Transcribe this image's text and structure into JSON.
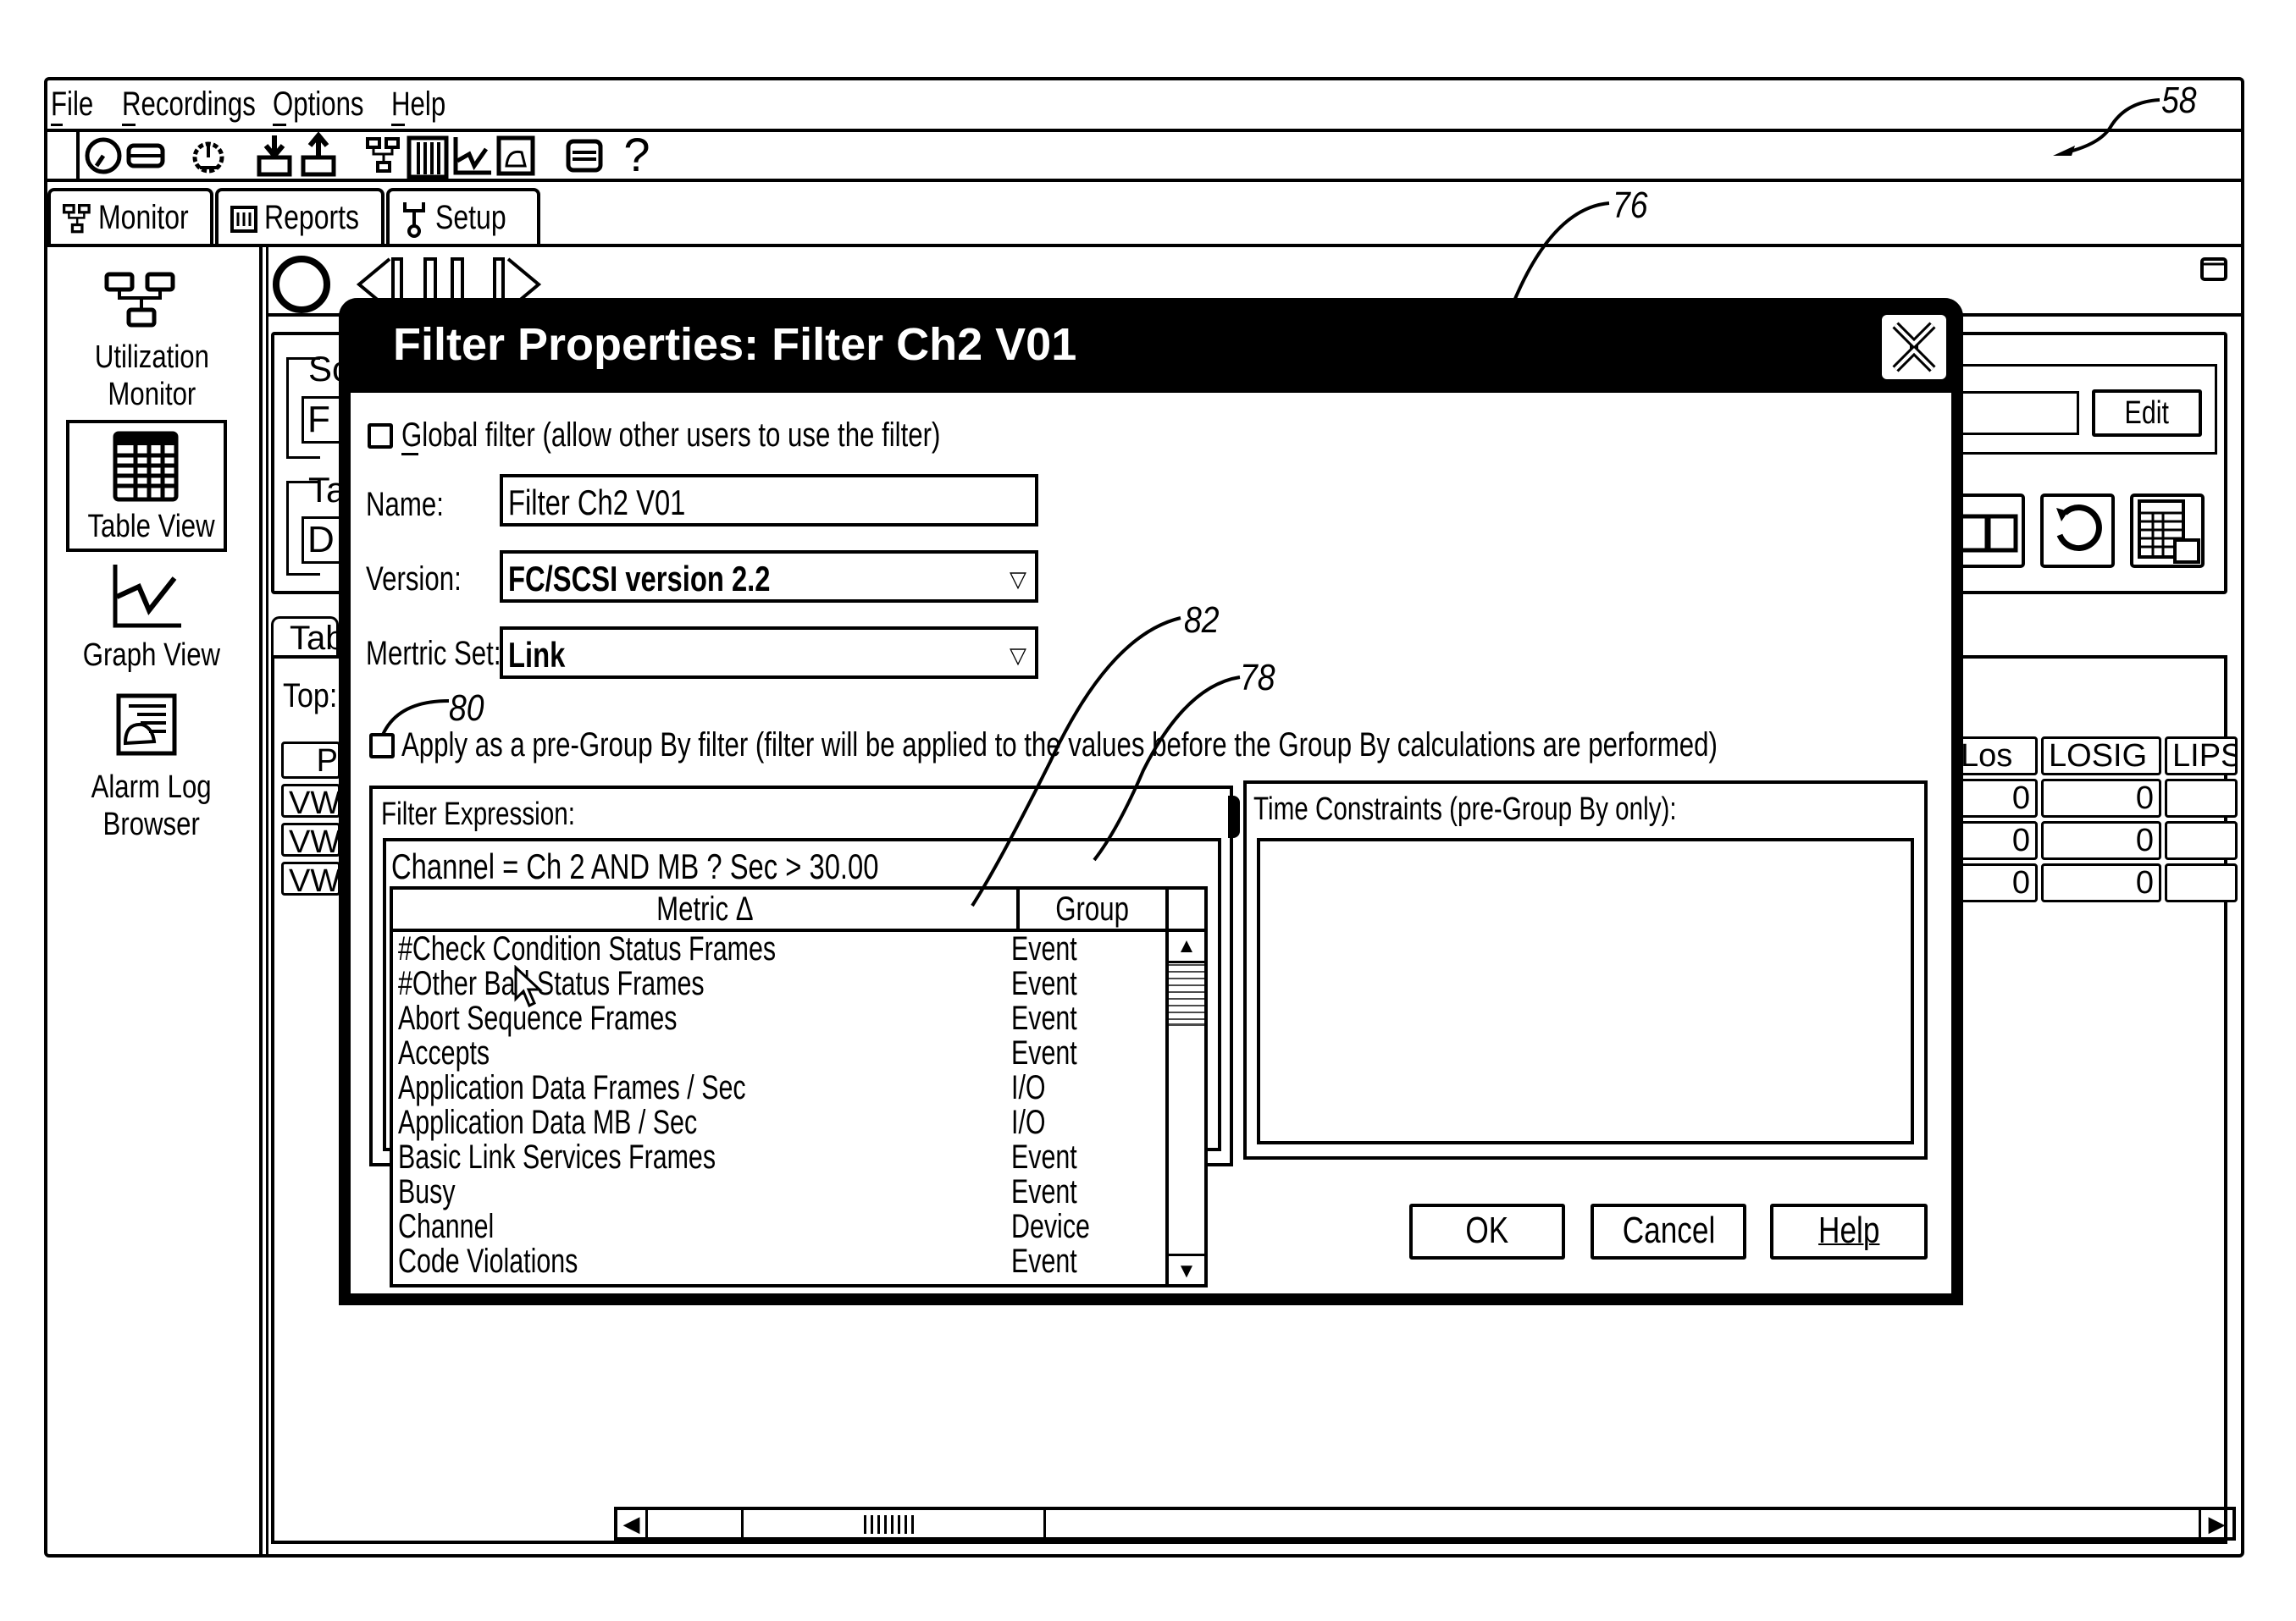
{
  "menu": {
    "items": [
      {
        "label": "File",
        "mnemonic": "F"
      },
      {
        "label": "Recordings",
        "mnemonic": "R"
      },
      {
        "label": "Options",
        "mnemonic": "O"
      },
      {
        "label": "Help",
        "mnemonic": "H"
      }
    ]
  },
  "toolbar": {
    "icons": [
      "stopwatch-icon",
      "tape-icon",
      "gear-meter-icon",
      "download-icon",
      "upload-icon",
      "network-icon",
      "table-icon",
      "graph-icon",
      "alarm-log-icon",
      "printer-icon",
      "help-icon"
    ],
    "help_glyph": "?"
  },
  "tabs": [
    {
      "label": "Monitor",
      "icon": "network-icon"
    },
    {
      "label": "Reports",
      "icon": "report-icon"
    },
    {
      "label": "Setup",
      "icon": "wrench-icon"
    }
  ],
  "sidebar": {
    "items": [
      {
        "label_line1": "Utilization",
        "label_line2": "Monitor",
        "icon": "network-icon",
        "selected": false
      },
      {
        "label_line1": "Table View",
        "label_line2": "",
        "icon": "table-icon",
        "selected": true
      },
      {
        "label_line1": "Graph View",
        "label_line2": "",
        "icon": "graph-icon",
        "selected": false
      },
      {
        "label_line1": "Alarm Log",
        "label_line2": "Browser",
        "icon": "alarm-log-icon",
        "selected": false
      }
    ]
  },
  "background": {
    "group1_label": "Sc",
    "group1_field": "F",
    "group2_label": "Ta",
    "group2_field": "D",
    "table_tab": "Tab",
    "top_label": "Top:",
    "col_p": "P",
    "rows_left": [
      "VWF",
      "VWF",
      "VWF"
    ],
    "edit_button": "Edit",
    "headers_right": [
      "Los",
      "LOSIG",
      "LIPS"
    ],
    "rows_right": [
      [
        "0",
        "0",
        ""
      ],
      [
        "0",
        "0",
        ""
      ],
      [
        "0",
        "0",
        ""
      ]
    ]
  },
  "dialog": {
    "title": "Filter Properties: Filter Ch2 V01",
    "close_glyph": "✕",
    "global_filter": {
      "label": "Global filter (allow other users to use the filter)",
      "checked": false
    },
    "name": {
      "label": "Name:",
      "value": "Filter Ch2 V01"
    },
    "version": {
      "label": "Version:",
      "value": "FC/SCSI version 2.2"
    },
    "metric_set": {
      "label": "Mertric Set:",
      "value": "Link"
    },
    "pre_group": {
      "label": "Apply as a pre-Group By filter (filter will be applied to the values before the Group By calculations are performed)",
      "checked": false
    },
    "filter_expression": {
      "label": "Filter Expression:",
      "value": "Channel = Ch 2 AND MB ? Sec > 30.00",
      "columns": {
        "metric": "Metric Δ",
        "group": "Group"
      },
      "rows": [
        {
          "metric": "#Check Condition Status Frames",
          "group": "Event"
        },
        {
          "metric": "#Other Bad Status Frames",
          "group": "Event"
        },
        {
          "metric": "Abort Sequence Frames",
          "group": "Event"
        },
        {
          "metric": "Accepts",
          "group": "Event"
        },
        {
          "metric": "Application Data Frames / Sec",
          "group": "I/O"
        },
        {
          "metric": "Application Data MB / Sec",
          "group": "I/O"
        },
        {
          "metric": "Basic Link Services Frames",
          "group": "Event"
        },
        {
          "metric": "Busy",
          "group": "Event"
        },
        {
          "metric": "Channel",
          "group": "Device"
        },
        {
          "metric": "Code Violations",
          "group": "Event"
        }
      ]
    },
    "time_constraints": {
      "label": "Time Constraints (pre-Group By only):",
      "value": ""
    },
    "buttons": {
      "ok": "OK",
      "cancel": "Cancel",
      "help": "Help"
    }
  },
  "annotations": {
    "window": "58",
    "dialog": "76",
    "pre_group_checkbox": "80",
    "metric_column": "82",
    "group_column": "78"
  }
}
